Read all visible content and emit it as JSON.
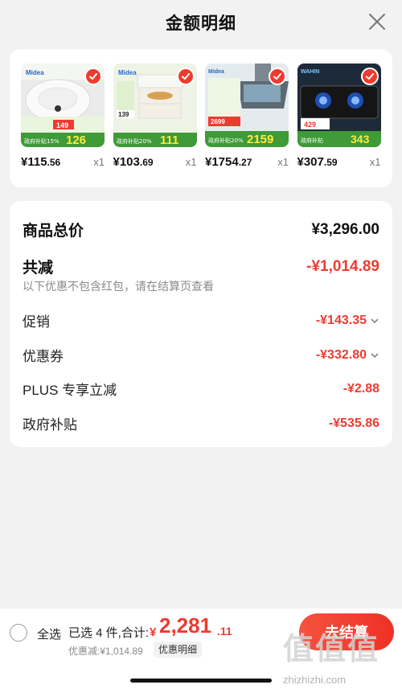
{
  "header": {
    "title": "金额明细"
  },
  "products": [
    {
      "price_int": "115",
      "price_dec": ".56",
      "qty": "x1",
      "tag": "126",
      "tag_old": "149",
      "badge": "政府补贴15%"
    },
    {
      "price_int": "103",
      "price_dec": ".69",
      "qty": "x1",
      "tag": "111",
      "tag_old": "139",
      "badge": "政府补贴20%"
    },
    {
      "price_int": "1754",
      "price_dec": ".27",
      "qty": "x1",
      "tag": "2159",
      "tag_old": "2699",
      "badge": "政府补贴20%"
    },
    {
      "price_int": "307",
      "price_dec": ".59",
      "qty": "x1",
      "tag": "343",
      "tag_old": "429",
      "badge": "政府补贴"
    }
  ],
  "currency": "¥",
  "summary": {
    "total_label": "商品总价",
    "total_value": "¥3,296.00",
    "reduce_label": "共减",
    "reduce_value": "-¥1,014.89",
    "note": "以下优惠不包含红包，请在结算页查看",
    "items": [
      {
        "label": "促销",
        "value": "-¥143.35",
        "expandable": true
      },
      {
        "label": "优惠券",
        "value": "-¥332.80",
        "expandable": true
      },
      {
        "label": "PLUS 专享立减",
        "value": "-¥2.88",
        "expandable": false
      },
      {
        "label": "政府补贴",
        "value": "-¥535.86",
        "expandable": false
      }
    ]
  },
  "bottom": {
    "select_all": "全选",
    "selected_info": "已选 4 件,合计:",
    "sum_yen": "¥",
    "sum_int": "2,281",
    "sum_dec": ".11",
    "discount_line": "优惠减:¥1,014.89",
    "detail_chip": "优惠明细",
    "checkout": "去结算"
  },
  "watermark": {
    "logo": "值值值",
    "url": "zhizhizhi.com"
  },
  "colors": {
    "accent": "#ee3b30",
    "bg": "#f2f2f2",
    "card": "#ffffff"
  }
}
